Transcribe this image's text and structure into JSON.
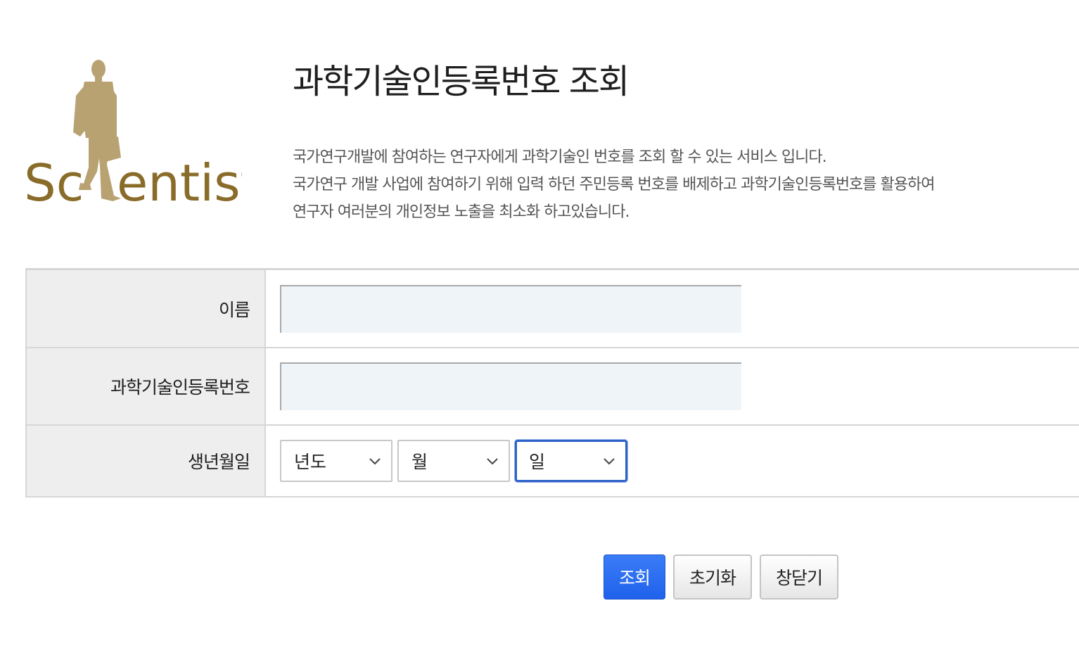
{
  "logo": {
    "text_left": "Sc",
    "text_right": "entist",
    "figure_icon": "walking-man-with-briefcase-icon"
  },
  "header": {
    "title": "과학기술인등록번호 조회",
    "description": [
      "국가연구개발에 참여하는 연구자에게 과학기술인 번호를 조회 할 수 있는 서비스 입니다.",
      "국가연구 개발 사업에 참여하기 위해 입력 하던 주민등록 번호를 배제하고 과학기술인등록번호를 활용하여",
      "연구자 여러분의 개인정보 노출을 최소화 하고있습니다."
    ]
  },
  "form": {
    "name_label": "이름",
    "name_value": "",
    "reg_number_label": "과학기술인등록번호",
    "reg_number_value": "",
    "birth_label": "생년월일",
    "birth_year": "년도",
    "birth_month": "월",
    "birth_day": "일"
  },
  "buttons": {
    "search": "조회",
    "reset": "초기화",
    "close": "창닫기"
  },
  "colors": {
    "logo_gold": "#b9a272",
    "logo_text": "#8a6c2a",
    "primary_button": "#2468f0",
    "focus_border": "#2f62c8",
    "label_background": "#eeeeee",
    "input_background": "#eef4f8"
  }
}
